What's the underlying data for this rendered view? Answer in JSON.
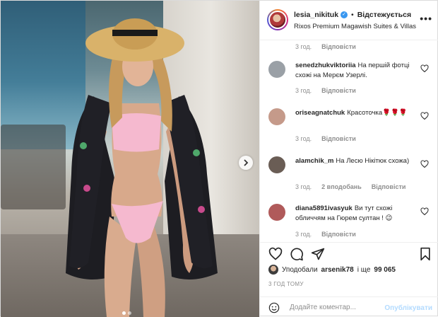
{
  "post": {
    "username": "lesia_nikituk",
    "verified": true,
    "follow_label": "Відстежується",
    "location": "Rixos Premium Magawish Suites & Villas",
    "more_label": "•••"
  },
  "comments": [
    {
      "meta_time": "3 год.",
      "reply_label": "Відповісти"
    },
    {
      "username": "senedzhukviktoriia",
      "text": "На першій фотці схожі на Мерєм Узерлі.",
      "time": "3 год.",
      "reply_label": "Відповісти",
      "avatar_color": "#9aa0a6"
    },
    {
      "username": "oriseagnatchuk",
      "text": "Красоточка🌹🌹🌹",
      "time": "3 год.",
      "reply_label": "Відповісти",
      "avatar_color": "#c59a8a"
    },
    {
      "username": "alamchik_m",
      "text": "На Лесю Нікітюк схожа)",
      "time": "3 год.",
      "likes": "2 вподобань",
      "reply_label": "Відповісти",
      "avatar_color": "#6a5d55"
    },
    {
      "username": "diana5891ivasyuk",
      "text": "Ви тут схожі обличчям на Гюрем султан ! 😉",
      "time": "3 год.",
      "reply_label": "Відповісти",
      "avatar_color": "#b05a5a"
    }
  ],
  "likes": {
    "prefix": "Уподобали",
    "user": "arsenik78",
    "suffix": "і ще",
    "count": "99 065"
  },
  "timestamp": "3 ГОД ТОМУ",
  "add_comment": {
    "placeholder": "Додайте коментар...",
    "publish_label": "Опублікувати"
  },
  "carousel": {
    "dots": 2,
    "active": 0
  },
  "colors": {
    "link_blue": "#3897f0",
    "publish_disabled": "#b3dbff",
    "meta_gray": "#8e8e8e"
  }
}
